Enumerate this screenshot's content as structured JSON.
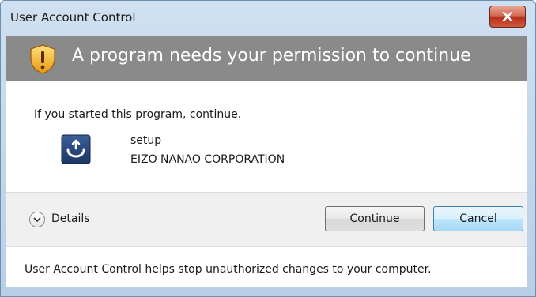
{
  "window": {
    "title": "User Account Control",
    "close_icon": "close-icon"
  },
  "header": {
    "icon": "shield-warning-icon",
    "text": "A program needs your permission to continue"
  },
  "prompt": "If you started this program, continue.",
  "program": {
    "icon": "setup-program-icon",
    "name": "setup",
    "publisher": "EIZO NANAO CORPORATION"
  },
  "footer": {
    "details_label": "Details",
    "continue_label": "Continue",
    "cancel_label": "Cancel"
  },
  "info": "User Account Control helps stop unauthorized changes to your computer.",
  "colors": {
    "header_band": "#8a8a8a",
    "close_button": "#c94a33",
    "cancel_focus": "#3c7fb1"
  }
}
